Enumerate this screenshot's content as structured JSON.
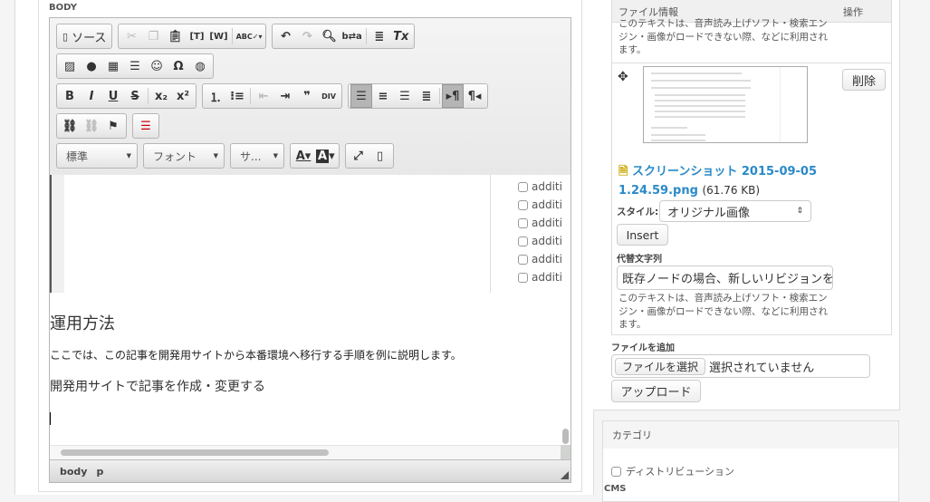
{
  "body_label": "BODY",
  "toolbar": {
    "source_label": "ソース",
    "format_combo": "標準",
    "font_combo": "フォント",
    "size_combo": "サ...",
    "icons": [
      "source",
      "cut",
      "copy",
      "paste",
      "paste-text",
      "paste-word",
      "spellcheck",
      "undo",
      "redo",
      "find",
      "replace",
      "select-all",
      "remove-format",
      "image",
      "flash",
      "table",
      "horizontal-rule",
      "smiley",
      "special-char",
      "iframe",
      "bold",
      "italic",
      "underline",
      "strike",
      "subscript",
      "superscript",
      "numbered-list",
      "bulleted-list",
      "outdent",
      "indent",
      "blockquote",
      "div",
      "align-left",
      "align-center",
      "align-right",
      "justify",
      "ltr",
      "rtl",
      "link",
      "unlink",
      "anchor",
      "page-break",
      "text-color",
      "bg-color",
      "maximize",
      "show-blocks"
    ]
  },
  "editor": {
    "checkbox_items": [
      "additi",
      "additi",
      "additi",
      "additi",
      "additi",
      "additi"
    ],
    "heading": "運用方法",
    "paragraph": "ここでは、この記事を開発用サイトから本番環境へ移行する手順を例に説明します。",
    "subheading": "開発用サイトで記事を作成・変更する",
    "path": [
      "body",
      "p"
    ]
  },
  "files": {
    "col_info": "ファイル情報",
    "col_ops": "操作",
    "prev_help": "このテキストは、音声読み上げソフト・検索エンジン・画像がロードできない際、などに利用されます。",
    "delete_label": "削除",
    "file_name": "スクリーンショット 2015-09-05 1.24.59.png",
    "file_size": "(61.76 KB)",
    "style_label": "スタイル:",
    "style_value": "オリジナル画像",
    "insert_label": "Insert",
    "alt_label": "代替文字列",
    "alt_value": "既存ノードの場合、新しいリビジョンを",
    "alt_help": "このテキストは、音声読み上げソフト・検索エンジン・画像がロードできない際、などに利用されます。",
    "add_label": "ファイルを追加",
    "choose_label": "ファイルを選択",
    "no_file": "選択されていません",
    "upload_label": "アップロード"
  },
  "category": {
    "title": "カテゴリ",
    "option": "ディストリビューション",
    "next_label": "CMS"
  },
  "colors": {
    "link": "#2a8ac8"
  }
}
